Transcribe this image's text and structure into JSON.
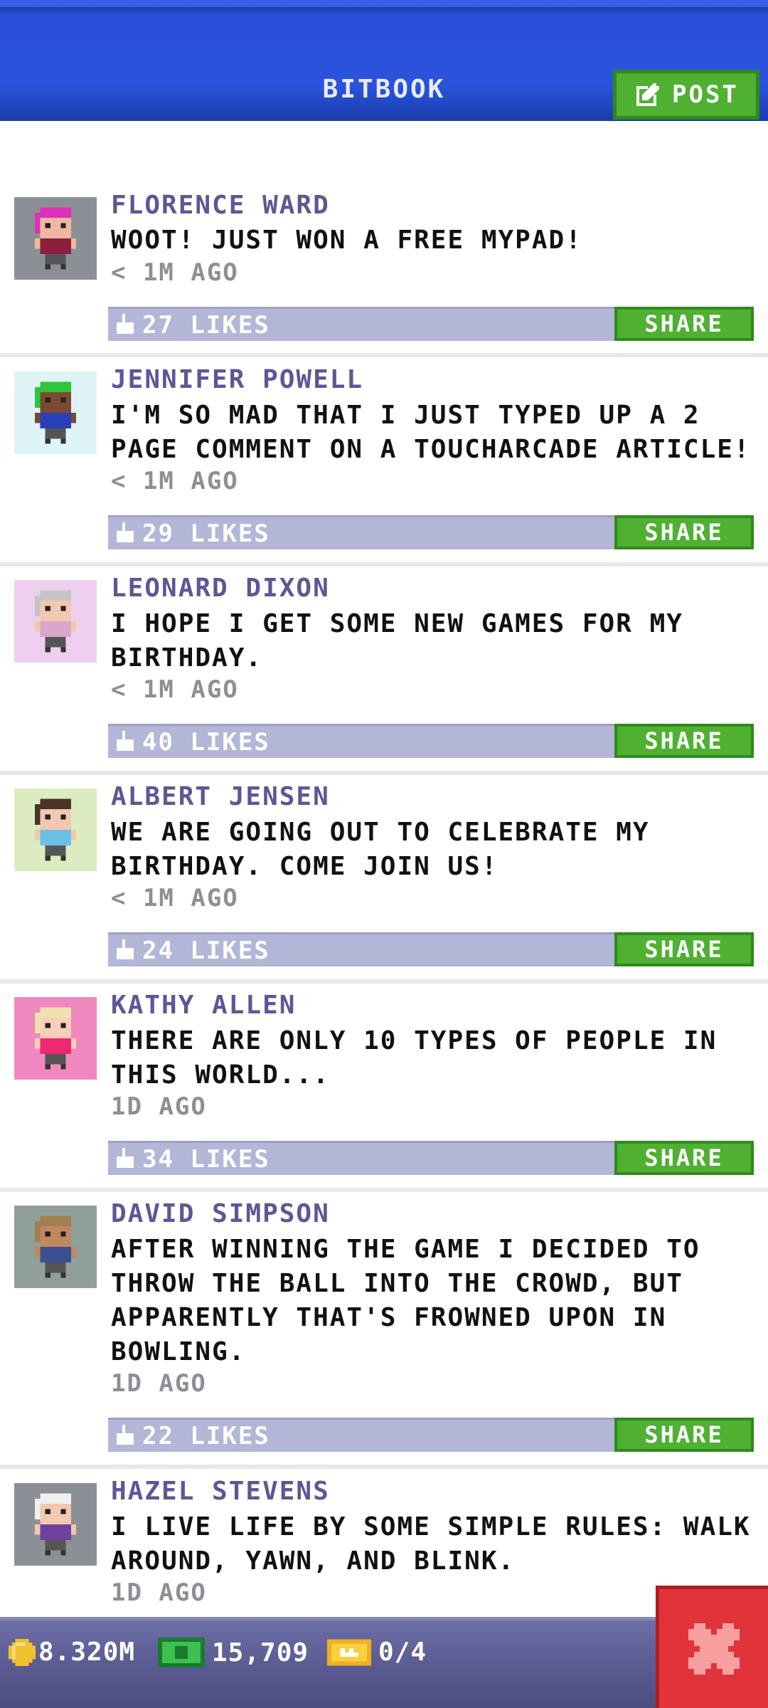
{
  "header": {
    "title": "BITBOOK",
    "post_label": "POST"
  },
  "posts": [
    {
      "name": "FLORENCE WARD",
      "text": "WOOT! JUST WON A FREE MYPAD!",
      "time": "< 1M AGO",
      "likes": "27 LIKES",
      "share": "SHARE",
      "avatar_bg": "#8a9096",
      "hair": "#e030b8",
      "shirt": "#8c1f3c",
      "skin": "#f0b8a0"
    },
    {
      "name": "JENNIFER POWELL",
      "text": "I'M SO MAD THAT I JUST TYPED UP A 2 PAGE COMMENT ON A TOUCHARCADE ARTICLE!",
      "time": "< 1M AGO",
      "likes": "29 LIKES",
      "share": "SHARE",
      "avatar_bg": "#dff4f6",
      "hair": "#2cc83a",
      "shirt": "#2a40b8",
      "skin": "#7a4a32"
    },
    {
      "name": "LEONARD DIXON",
      "text": "I HOPE I GET SOME NEW GAMES FOR MY BIRTHDAY.",
      "time": "< 1M AGO",
      "likes": "40 LIKES",
      "share": "SHARE",
      "avatar_bg": "#eed0ee",
      "hair": "#c4c4c4",
      "shirt": "#d8a8c8",
      "skin": "#f2c8b0"
    },
    {
      "name": "ALBERT JENSEN",
      "text": "WE ARE GOING OUT TO CELEBRATE MY BIRTHDAY. COME JOIN US!",
      "time": "< 1M AGO",
      "likes": "24 LIKES",
      "share": "SHARE",
      "avatar_bg": "#dcecc0",
      "hair": "#4a3428",
      "shirt": "#6cc0e8",
      "skin": "#f2c8b0"
    },
    {
      "name": "KATHY ALLEN",
      "text": "THERE ARE ONLY 10 TYPES OF PEOPLE IN THIS WORLD...",
      "time": "1D AGO",
      "likes": "34 LIKES",
      "share": "SHARE",
      "avatar_bg": "#f088c0",
      "hair": "#f0e0b0",
      "shirt": "#f02870",
      "skin": "#f8d0b8"
    },
    {
      "name": "DAVID SIMPSON",
      "text": "AFTER WINNING THE GAME I DECIDED TO THROW THE BALL INTO THE CROWD, BUT APPARENTLY THAT'S FROWNED UPON IN BOWLING.",
      "time": "1D AGO",
      "likes": "22 LIKES",
      "share": "SHARE",
      "avatar_bg": "#90a098",
      "hair": "#a08050",
      "shirt": "#3a5090",
      "skin": "#c08860"
    },
    {
      "name": "HAZEL STEVENS",
      "text": "I LIVE LIFE BY SOME SIMPLE RULES: WALK AROUND, YAWN, AND BLINK.",
      "time": "1D AGO",
      "likes": "",
      "share": "",
      "avatar_bg": "#8a9096",
      "hair": "#f0f0f0",
      "shirt": "#7040a0",
      "skin": "#f2c8b0"
    }
  ],
  "bottom": {
    "coins": "8.320M",
    "cash": "15,709",
    "tickets": "0/4"
  },
  "colors": {
    "accent_green": "#4fb032",
    "header_blue": "#2a53de",
    "close_red": "#e0343a",
    "name_purple": "#5c5796"
  }
}
